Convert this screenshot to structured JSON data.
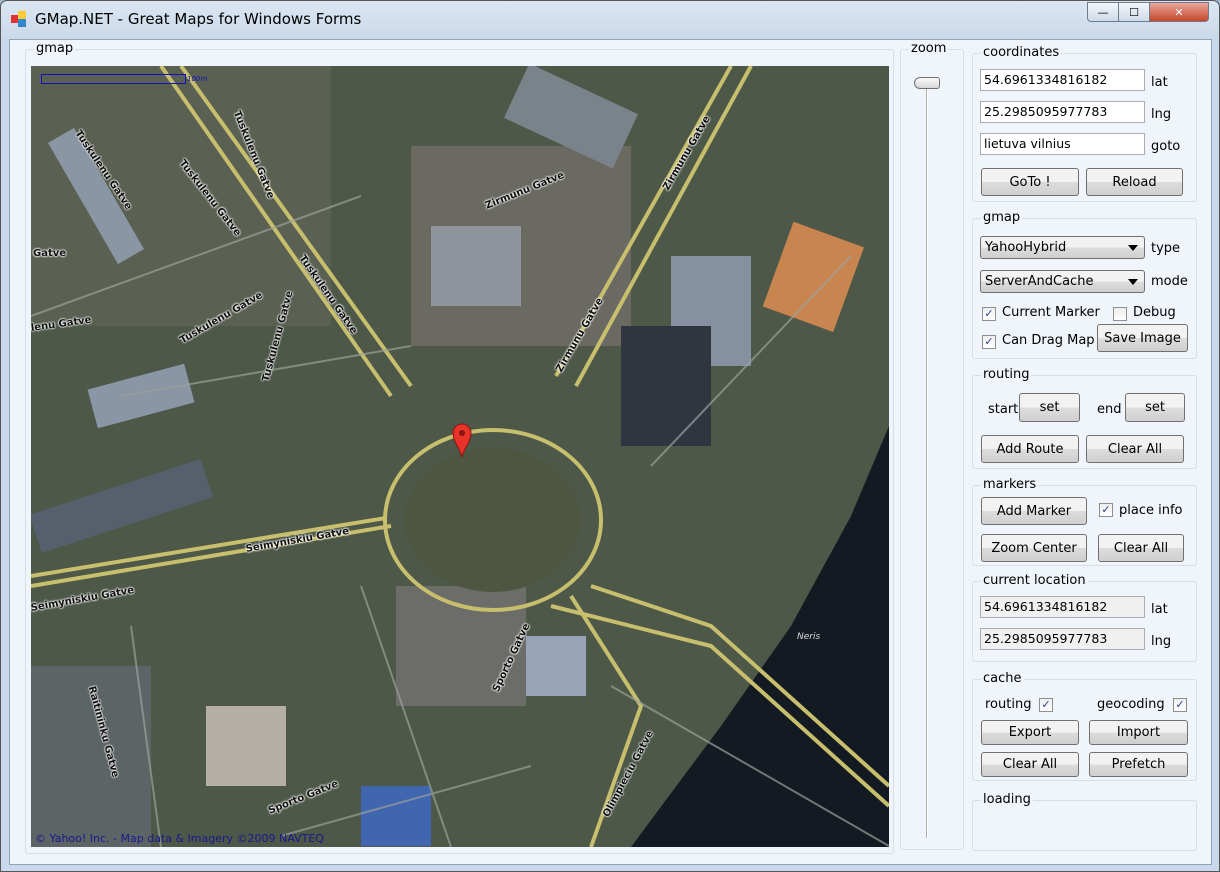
{
  "window": {
    "title": "GMap.NET - Great Maps for Windows Forms",
    "minimize": "—",
    "maximize": "☐",
    "close": "✕"
  },
  "map": {
    "group_label": "gmap",
    "scale_label": "100m",
    "copyright": "© Yahoo! Inc. - Map data & Imagery ©2009 NAVTEQ",
    "river_label": "Neris",
    "streets": [
      "Tuskulenu Gatve",
      "Tuskulenu Gatve",
      "Tuskulenu Gatve",
      "Tuskulenu Gatve",
      "Tuskulenu Gatve",
      "Tuskulenu Gatve",
      "Zirmunu Gatve",
      "Zirmunu Gatve",
      "Zirmunu Gatve",
      "Seimyniskiu Gatve",
      "Seimyniskiu Gatve",
      "Sporto Gatve",
      "Sporto Gatve",
      "Olimpieciu Gatve",
      "Raitininku Gatve",
      "Gatve",
      "lenu Gatve"
    ],
    "marker_color": "#e8332a"
  },
  "zoom": {
    "label": "zoom",
    "value_fraction": 1.0
  },
  "coordinates": {
    "label": "coordinates",
    "lat_value": "54.6961334816182",
    "lat_label": "lat",
    "lng_value": "25.2985095977783",
    "lng_label": "lng",
    "goto_value": "lietuva vilnius",
    "goto_label": "goto",
    "goto_button": "GoTo !",
    "reload_button": "Reload"
  },
  "gmap": {
    "label": "gmap",
    "type_value": "YahooHybrid",
    "type_label": "type",
    "mode_value": "ServerAndCache",
    "mode_label": "mode",
    "current_marker": "Current Marker",
    "current_marker_checked": true,
    "debug": "Debug",
    "debug_checked": false,
    "can_drag": "Can Drag Map",
    "can_drag_checked": true,
    "save_image": "Save Image",
    "check": "✓"
  },
  "routing": {
    "label": "routing",
    "start": "start",
    "set1": "set",
    "end": "end",
    "set2": "set",
    "add_route": "Add Route",
    "clear_all": "Clear All"
  },
  "markers": {
    "label": "markers",
    "add_marker": "Add Marker",
    "place_info": "place info",
    "place_info_checked": true,
    "zoom_center": "Zoom Center",
    "clear_all": "Clear All"
  },
  "current_location": {
    "label": "current location",
    "lat_value": "54.6961334816182",
    "lat_label": "lat",
    "lng_value": "25.2985095977783",
    "lng_label": "lng"
  },
  "cache": {
    "label": "cache",
    "routing": "routing",
    "routing_checked": true,
    "geocoding": "geocoding",
    "geocoding_checked": true,
    "export": "Export",
    "import": "Import",
    "clear_all": "Clear All",
    "prefetch": "Prefetch"
  },
  "loading": {
    "label": "loading"
  }
}
